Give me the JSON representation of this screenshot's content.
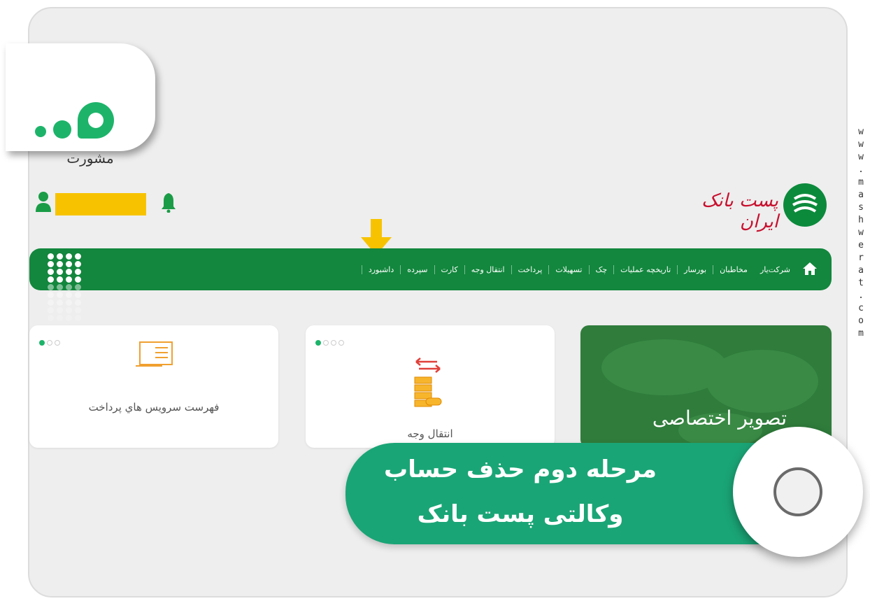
{
  "watermark": "www.mashwerat.com",
  "logo": {
    "text": "مشورت"
  },
  "brand": {
    "name": "پست بانک ایران"
  },
  "nav": {
    "items": [
      "داشبورد",
      "سپرده",
      "کارت",
      "انتقال وجه",
      "پرداخت",
      "تسهیلات",
      "چک",
      "تاریخچه عملیات",
      "بورسار",
      "مخاطبان",
      "شرکت‌یار"
    ]
  },
  "cards": {
    "services": {
      "title": "فهرست سرويس هاي پرداخت"
    },
    "transfer": {
      "title": "انتقال وجه"
    },
    "image": {
      "title": "تصویر اختصاصی"
    }
  },
  "banner": {
    "line1": "مرحله دوم حذف حساب",
    "line2": "وکالتی پست بانک"
  },
  "colors": {
    "nav_green": "#12873d",
    "banner_green": "#1aa576",
    "brand_red": "#c8102e",
    "highlight_yellow": "#f7c300"
  }
}
